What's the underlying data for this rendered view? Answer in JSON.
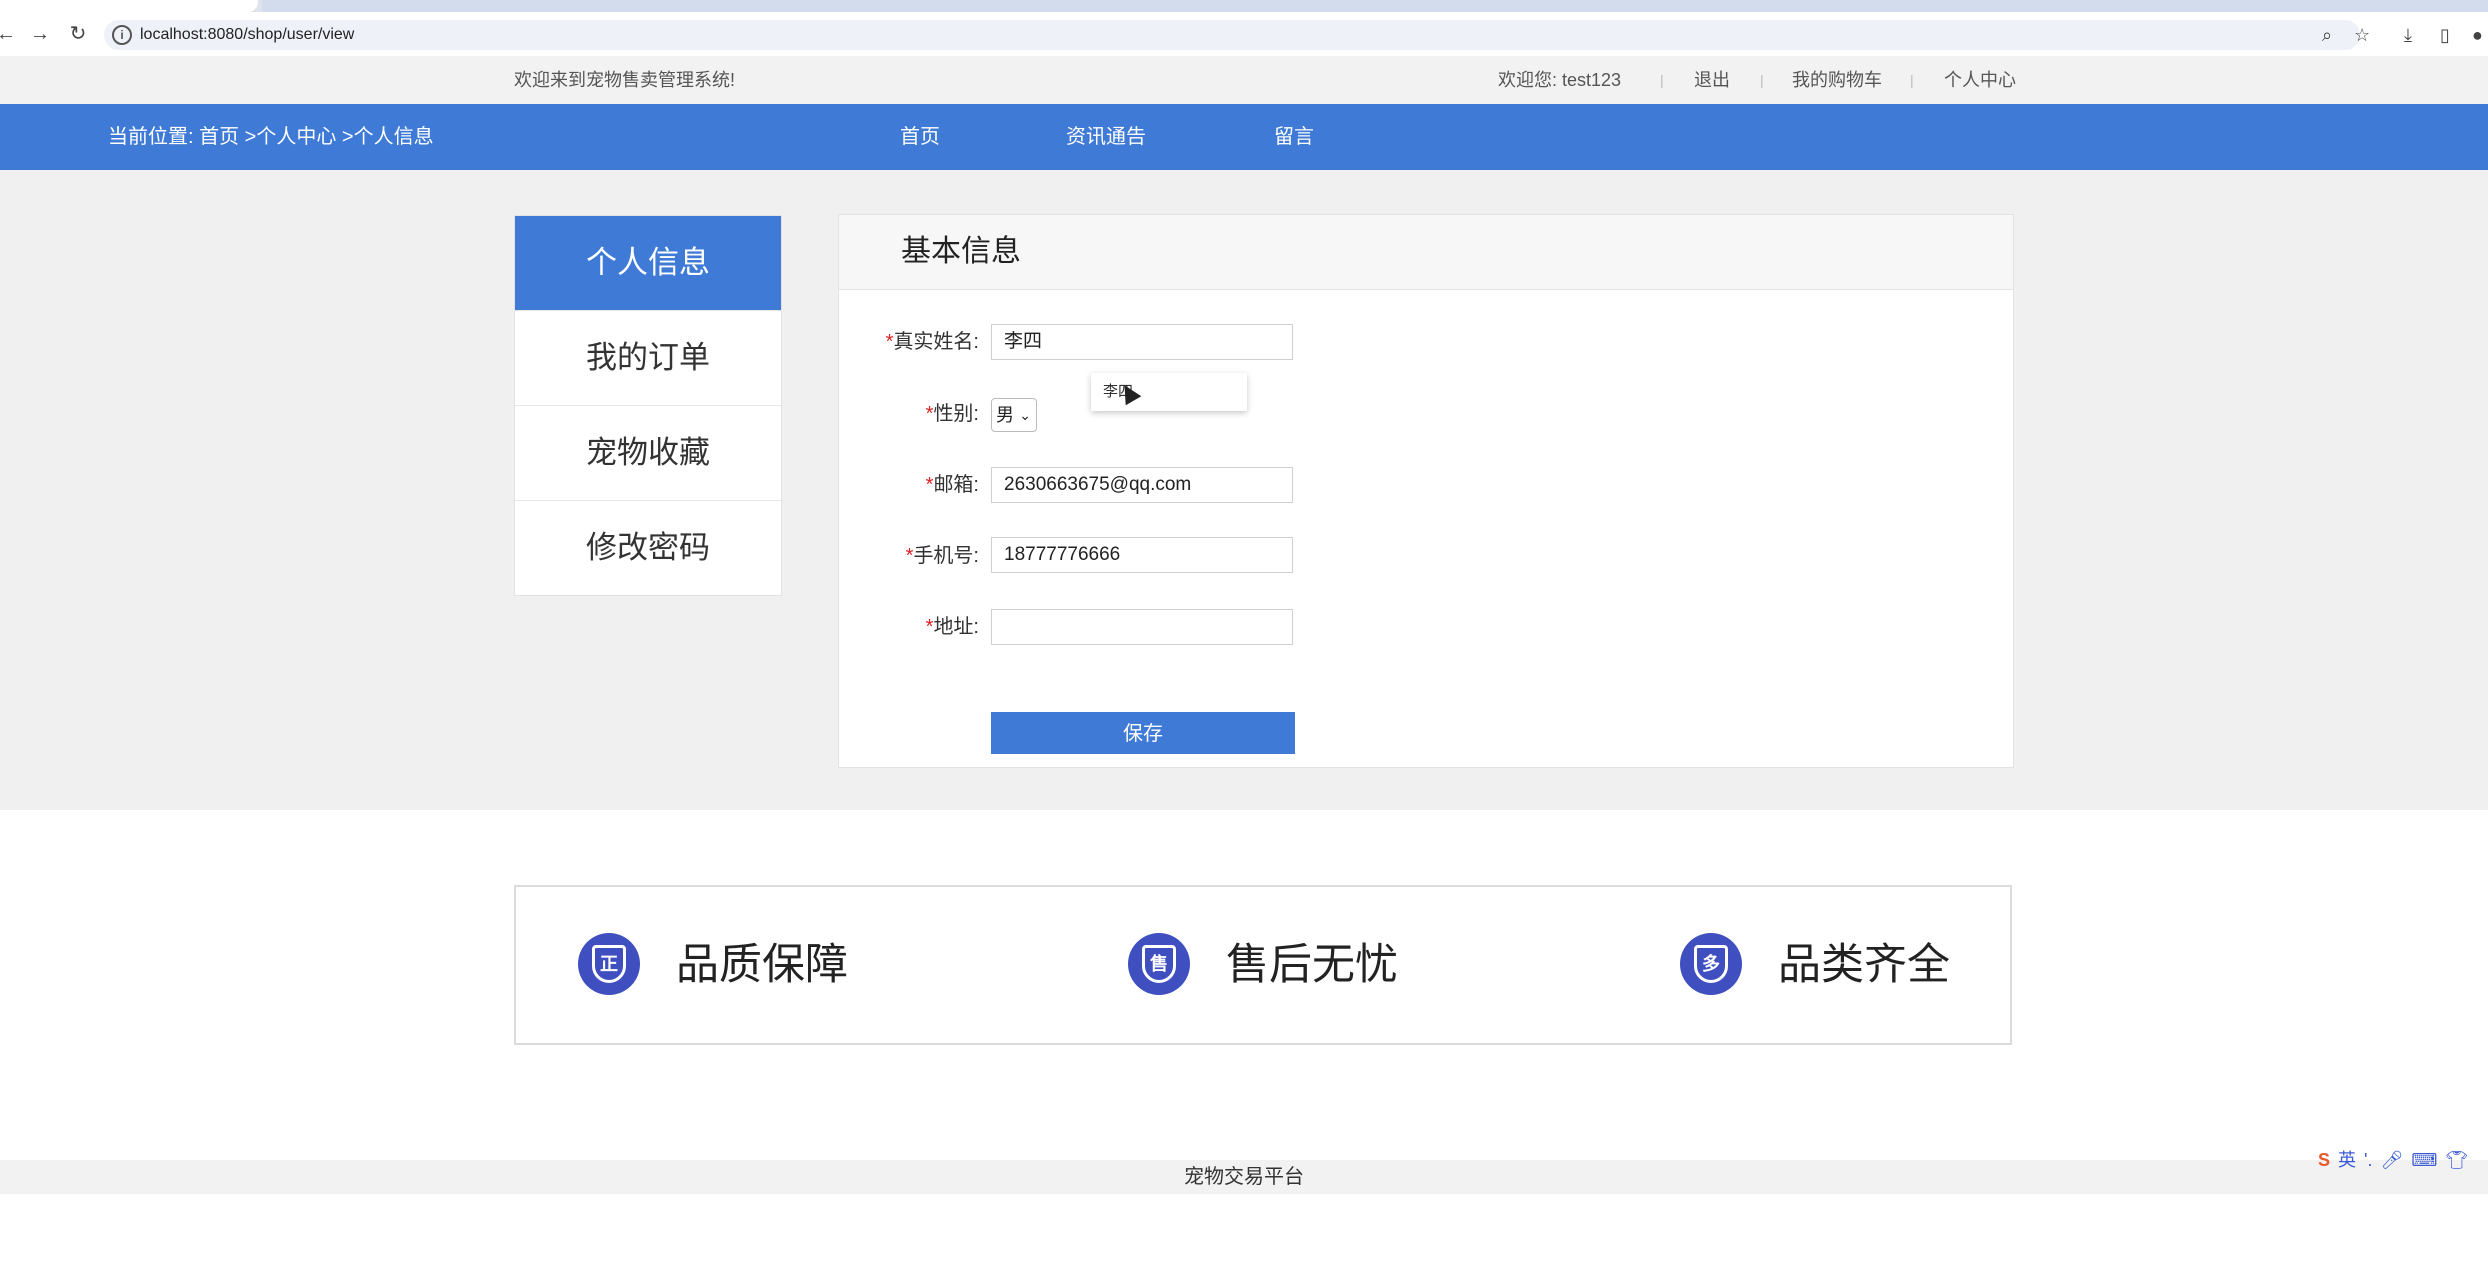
{
  "browser": {
    "url": "localhost:8080/shop/user/view",
    "icons": [
      "back-icon",
      "forward-icon",
      "reload-icon",
      "info-icon",
      "zoom-icon",
      "star-icon",
      "download-icon",
      "sidepanel-icon",
      "profile-icon"
    ]
  },
  "topbar": {
    "welcome": "欢迎来到宠物售卖管理系统!",
    "user_greeting": "欢迎您:  test123",
    "logout": "退出",
    "cart": "我的购物车",
    "user_center": "个人中心",
    "separator": "|"
  },
  "nav": {
    "breadcrumb": "当前位置:  首页 >个人中心 >个人信息",
    "links": [
      "首页",
      "资讯通告",
      "留言"
    ]
  },
  "sidebar": {
    "items": [
      {
        "label": "个人信息",
        "active": true
      },
      {
        "label": "我的订单",
        "active": false
      },
      {
        "label": "宠物收藏",
        "active": false
      },
      {
        "label": "修改密码",
        "active": false
      }
    ]
  },
  "panel": {
    "title": "基本信息",
    "required_mark": "*",
    "fields": {
      "real_name": {
        "label": "真实姓名:",
        "value": "李四"
      },
      "gender": {
        "label": "性别:",
        "value": "男"
      },
      "email": {
        "label": "邮箱:",
        "value": "2630663675@qq.com"
      },
      "phone": {
        "label": "手机号:",
        "value": "18777776666"
      },
      "address": {
        "label": "地址:",
        "value": ""
      }
    },
    "autocomplete_suggestion": "李四",
    "save_label": "保存"
  },
  "features": [
    {
      "icon_text": "正",
      "label": "品质保障",
      "icon": "quality-shield-icon"
    },
    {
      "icon_text": "售",
      "label": "售后无忧",
      "icon": "aftersale-shield-icon"
    },
    {
      "icon_text": "多",
      "label": "品类齐全",
      "icon": "variety-shield-icon"
    }
  ],
  "footer": {
    "text": "宠物交易平台"
  },
  "ime_toolbar": {
    "lang": "英"
  },
  "colors": {
    "primary": "#3e7ad6",
    "feature_icon": "#3f4fc0",
    "required": "#e02020"
  }
}
